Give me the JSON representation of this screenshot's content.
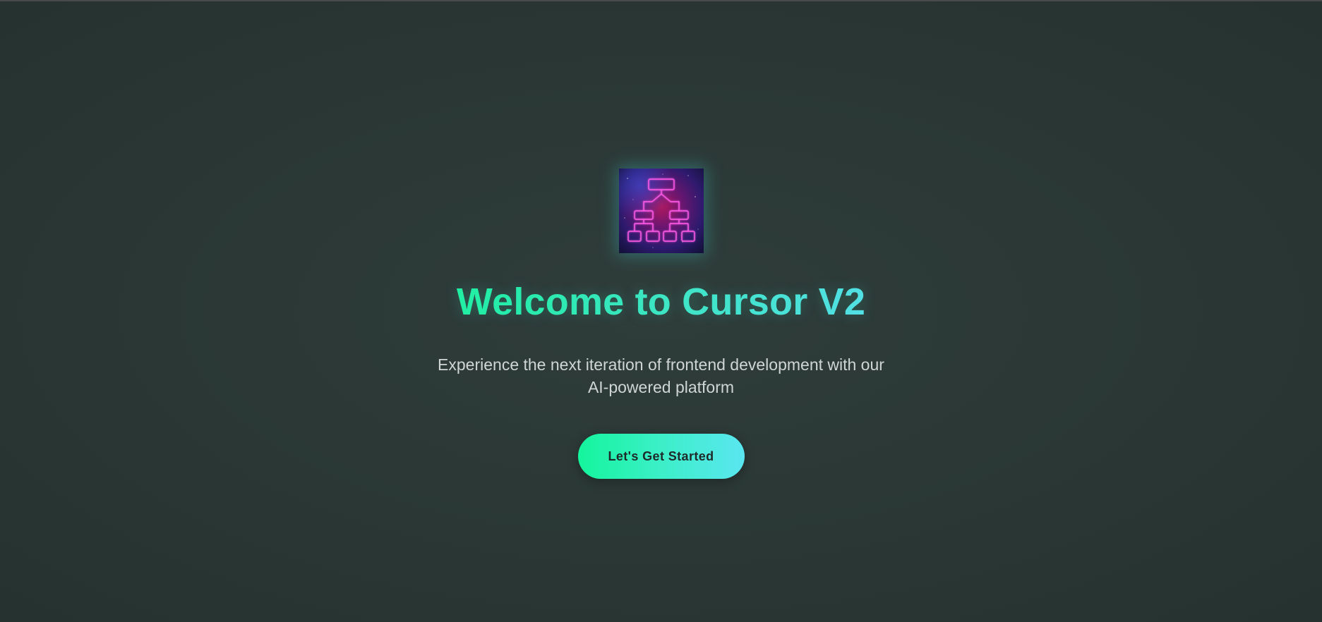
{
  "hero": {
    "logo_icon": "network-hierarchy-icon",
    "title": "Welcome to Cursor V2",
    "subtitle": "Experience the next iteration of frontend development with our AI-powered platform",
    "cta_label": "Let's Get Started"
  },
  "colors": {
    "background": "#2b3836",
    "accent_start": "#14f59c",
    "accent_end": "#5ae6f0",
    "logo_neon": "#ff4fe0",
    "subtitle_text": "#cfd6d4",
    "button_text": "#1e2a2a"
  }
}
